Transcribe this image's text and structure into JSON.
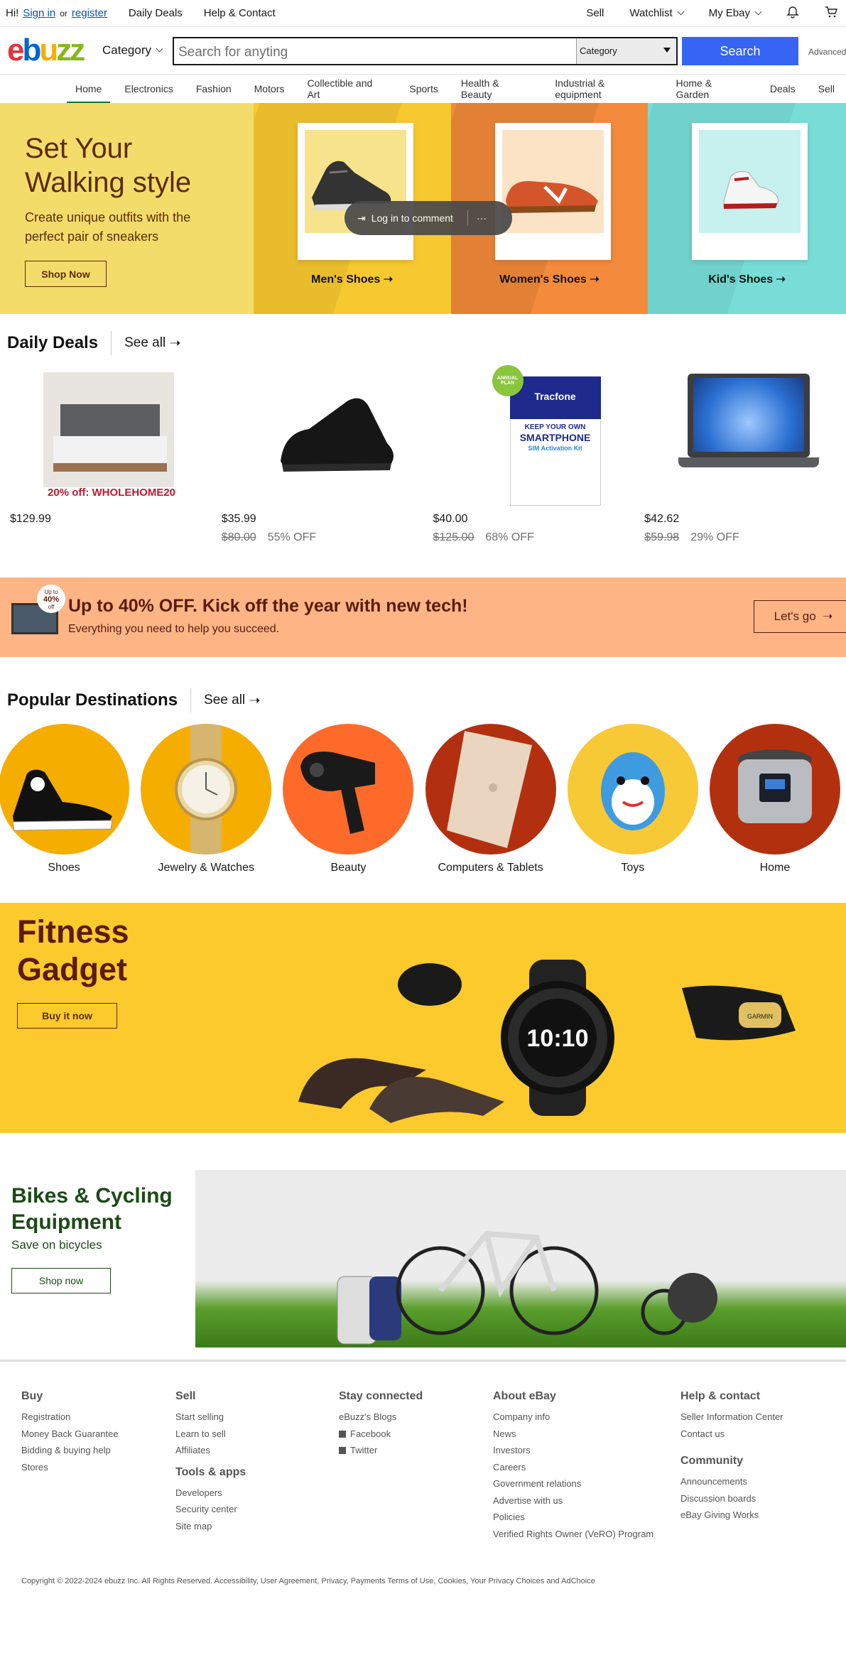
{
  "topbar": {
    "greeting": "Hi!",
    "sign_in": "Sign in",
    "or": "or",
    "register": "register",
    "daily_deals": "Daily Deals",
    "help_contact": "Help & Contact",
    "sell": "Sell",
    "watchlist": "Watchlist",
    "my_ebay": "My Ebay"
  },
  "header": {
    "logo_letters": [
      "e",
      "b",
      "u",
      "z",
      "z"
    ],
    "category": "Category",
    "search_placeholder": "Search for anyting",
    "search_category": "Category",
    "search_button": "Search",
    "advanced": "Advanced"
  },
  "nav": [
    "Home",
    "Electronics",
    "Fashion",
    "Motors",
    "Collectible and Art",
    "Sports",
    "Health & Beauty",
    "Industrial & equipment",
    "Home & Garden",
    "Deals",
    "Sell"
  ],
  "hero": {
    "title": "Set Your Walking style",
    "subtitle": "Create unique outfits with the perfect pair of sneakers",
    "button": "Shop Now",
    "panels": [
      {
        "label": "Men's Shoes",
        "color": "#f7c830",
        "card": "#f7e38b"
      },
      {
        "label": "Women's Shoes",
        "color": "#f48a3b",
        "card": "#fde3c5"
      },
      {
        "label": "Kid's Shoes",
        "color": "#78ddd6",
        "card": "#c6f1ee"
      }
    ]
  },
  "toast": {
    "text": "Log in to comment",
    "more": "···"
  },
  "daily_deals": {
    "title": "Daily Deals",
    "see_all": "See all",
    "items": [
      {
        "price": "$129.99",
        "promo": "20% off: WHOLEHOME20",
        "orig": "",
        "off": ""
      },
      {
        "price": "$35.99",
        "orig": "$80.00",
        "off": "55% OFF"
      },
      {
        "price": "$40.00",
        "orig": "$125.00",
        "off": "68% OFF"
      },
      {
        "price": "$42.62",
        "orig": "$59.98",
        "off": "29% OFF"
      }
    ],
    "sim_card": {
      "badge": "ANNUAL PLAN",
      "brand": "Tracfone",
      "line1": "KEEP YOUR OWN",
      "line2": "SMARTPHONE",
      "line3": "SIM Activation Kit"
    }
  },
  "promo": {
    "badge_small": "Up to",
    "badge_pct": "40%",
    "badge_off": "off",
    "title": "Up to 40% OFF. Kick off the year with new tech!",
    "subtitle": "Everything you need to help you succeed.",
    "button": "Let's go"
  },
  "popular": {
    "title": "Popular Destinations",
    "see_all": "See all",
    "items": [
      {
        "label": "Shoes",
        "color": "#f5ad00"
      },
      {
        "label": "Jewelry & Watches",
        "color": "#f5ad00"
      },
      {
        "label": "Beauty",
        "color": "#fe6a2a"
      },
      {
        "label": "Computers & Tablets",
        "color": "#b2300f"
      },
      {
        "label": "Toys",
        "color": "#f7c936"
      },
      {
        "label": "Home",
        "color": "#b3300f"
      }
    ]
  },
  "fitness": {
    "title": "Fitness Gadget",
    "button": "Buy it now",
    "watch_time": "10:10",
    "brand": "GARMIN"
  },
  "bikes": {
    "title": "Bikes & Cycling Equipment",
    "subtitle": "Save on bicycles",
    "button": "Shop now"
  },
  "footer": {
    "columns": [
      {
        "heading": "Buy",
        "links": [
          "Registration",
          "Money Back Guarantee",
          "Bidding & buying help",
          "Stores"
        ]
      },
      {
        "heading": "Sell",
        "links": [
          "Start selling",
          "Learn to sell",
          "Affiliates"
        ],
        "heading2": "Tools & apps",
        "links2": [
          "Developers",
          "Security center",
          "Site map"
        ]
      },
      {
        "heading": "Stay connected",
        "links": [
          "eBuzz's Blogs",
          "Facebook",
          "Twitter"
        ]
      },
      {
        "heading": "About eBay",
        "links": [
          "Company info",
          "News",
          "Investors",
          "Careers",
          "Government relations",
          "Advertise with us",
          "Policies",
          "Verified Rights Owner (VeRO) Program"
        ]
      },
      {
        "heading": "Help & contact",
        "links": [
          "Seller Information Center",
          "Contact us"
        ],
        "heading2": "Community",
        "links2": [
          "Announcements",
          "Discussion boards",
          "eBay Giving Works"
        ]
      }
    ],
    "copyright": "Copyright © 2022-2024 ebuzz Inc. All Rights Reserved. Accessibility, User Agreement, Privacy, Payments Terms of Use, Cookies, Your Privacy Choices and AdChoice"
  },
  "colors": {
    "accent": "#3665f3",
    "link": "#0654ba",
    "nav_active": "#007a33"
  }
}
